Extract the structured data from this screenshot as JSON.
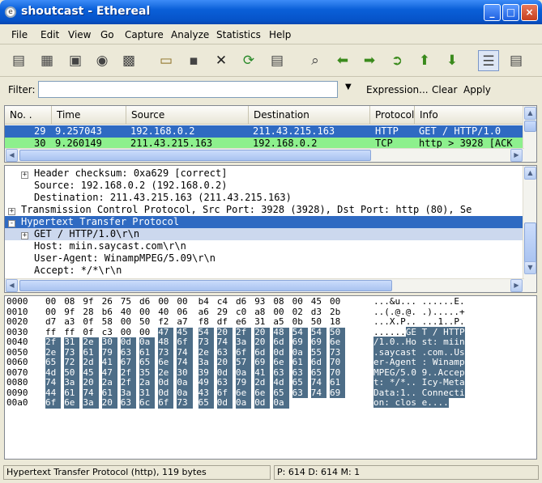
{
  "window": {
    "title": "shoutcast - Ethereal",
    "icon": "ethereal-app-icon"
  },
  "menu": [
    "File",
    "Edit",
    "View",
    "Go",
    "Capture",
    "Analyze",
    "Statistics",
    "Help"
  ],
  "toolbar_icons": [
    "interface-list-icon",
    "capture-options-icon",
    "start-capture-icon",
    "stop-capture-icon",
    "restart-capture-icon",
    "open-file-icon",
    "save-file-icon",
    "close-file-icon",
    "reload-icon",
    "print-icon",
    "find-packet-icon",
    "go-back-icon",
    "go-forward-icon",
    "go-to-packet-icon",
    "go-first-icon",
    "go-last-icon",
    "colorize-icon",
    "auto-scroll-icon"
  ],
  "filter": {
    "label": "Filter:",
    "value": "",
    "expression": "Expression...",
    "clear": "Clear",
    "apply": "Apply"
  },
  "packet_list": {
    "columns": [
      "No. .",
      "Time",
      "Source",
      "Destination",
      "Protocol",
      "Info"
    ],
    "rows": [
      {
        "no": "29",
        "time": "9.257043",
        "source": "192.168.0.2",
        "destination": "211.43.215.163",
        "protocol": "HTTP",
        "info": "GET / HTTP/1.0",
        "bg": "#2f6ac2",
        "fg": "#ffffff"
      },
      {
        "no": "30",
        "time": "9.260149",
        "source": "211.43.215.163",
        "destination": "192.168.0.2",
        "protocol": "TCP",
        "info": "http > 3928 [ACK",
        "bg": "#8df08d",
        "fg": "#000000"
      }
    ]
  },
  "details": {
    "rows": [
      {
        "indent": 1,
        "expander": "+",
        "text": "Header checksum: 0xa629 [correct]"
      },
      {
        "indent": 2,
        "expander": "",
        "text": "Source: 192.168.0.2 (192.168.0.2)"
      },
      {
        "indent": 2,
        "expander": "",
        "text": "Destination: 211.43.215.163 (211.43.215.163)"
      },
      {
        "indent": 0,
        "expander": "+",
        "text": "Transmission Control Protocol, Src Port: 3928 (3928), Dst Port: http (80), Se"
      },
      {
        "indent": 0,
        "expander": "-",
        "text": "Hypertext Transfer Protocol",
        "selected": true
      },
      {
        "indent": 1,
        "expander": "+",
        "text": "GET / HTTP/1.0\\r\\n",
        "sub": true
      },
      {
        "indent": 2,
        "expander": "",
        "text": "Host: miin.saycast.com\\r\\n"
      },
      {
        "indent": 2,
        "expander": "",
        "text": "User-Agent: WinampMPEG/5.09\\r\\n"
      },
      {
        "indent": 2,
        "expander": "",
        "text": "Accept: */*\\r\\n"
      }
    ]
  },
  "hex": {
    "rows": [
      {
        "offset": "0000",
        "bytes": [
          "00",
          "08",
          "9f",
          "26",
          "75",
          "d6",
          "00",
          "00",
          "b4",
          "c4",
          "d6",
          "93",
          "08",
          "00",
          "45",
          "00"
        ],
        "ascii": "...&u... ......E.",
        "hl_start": -1
      },
      {
        "offset": "0010",
        "bytes": [
          "00",
          "9f",
          "28",
          "b6",
          "40",
          "00",
          "40",
          "06",
          "a6",
          "29",
          "c0",
          "a8",
          "00",
          "02",
          "d3",
          "2b"
        ],
        "ascii": "..(.@.@. .).....+",
        "hl_start": -1
      },
      {
        "offset": "0020",
        "bytes": [
          "d7",
          "a3",
          "0f",
          "58",
          "00",
          "50",
          "f2",
          "a7",
          "f8",
          "df",
          "e6",
          "31",
          "a5",
          "0b",
          "50",
          "18"
        ],
        "ascii": "...X.P.. ...1..P.",
        "hl_start": -1
      },
      {
        "offset": "0030",
        "bytes": [
          "ff",
          "ff",
          "0f",
          "c3",
          "00",
          "00",
          "47",
          "45",
          "54",
          "20",
          "2f",
          "20",
          "48",
          "54",
          "54",
          "50"
        ],
        "ascii": "......GE T / HTTP",
        "hl_start": 6
      },
      {
        "offset": "0040",
        "bytes": [
          "2f",
          "31",
          "2e",
          "30",
          "0d",
          "0a",
          "48",
          "6f",
          "73",
          "74",
          "3a",
          "20",
          "6d",
          "69",
          "69",
          "6e"
        ],
        "ascii": "/1.0..Ho st: miin",
        "hl_start": 0
      },
      {
        "offset": "0050",
        "bytes": [
          "2e",
          "73",
          "61",
          "79",
          "63",
          "61",
          "73",
          "74",
          "2e",
          "63",
          "6f",
          "6d",
          "0d",
          "0a",
          "55",
          "73"
        ],
        "ascii": ".saycast .com..Us",
        "hl_start": 0
      },
      {
        "offset": "0060",
        "bytes": [
          "65",
          "72",
          "2d",
          "41",
          "67",
          "65",
          "6e",
          "74",
          "3a",
          "20",
          "57",
          "69",
          "6e",
          "61",
          "6d",
          "70"
        ],
        "ascii": "er-Agent : Winamp",
        "hl_start": 0
      },
      {
        "offset": "0070",
        "bytes": [
          "4d",
          "50",
          "45",
          "47",
          "2f",
          "35",
          "2e",
          "30",
          "39",
          "0d",
          "0a",
          "41",
          "63",
          "63",
          "65",
          "70"
        ],
        "ascii": "MPEG/5.0 9..Accep",
        "hl_start": 0
      },
      {
        "offset": "0080",
        "bytes": [
          "74",
          "3a",
          "20",
          "2a",
          "2f",
          "2a",
          "0d",
          "0a",
          "49",
          "63",
          "79",
          "2d",
          "4d",
          "65",
          "74",
          "61"
        ],
        "ascii": "t: */*.. Icy-Meta",
        "hl_start": 0
      },
      {
        "offset": "0090",
        "bytes": [
          "44",
          "61",
          "74",
          "61",
          "3a",
          "31",
          "0d",
          "0a",
          "43",
          "6f",
          "6e",
          "6e",
          "65",
          "63",
          "74",
          "69"
        ],
        "ascii": "Data:1.. Connecti",
        "hl_start": 0
      },
      {
        "offset": "00a0",
        "bytes": [
          "6f",
          "6e",
          "3a",
          "20",
          "63",
          "6c",
          "6f",
          "73",
          "65",
          "0d",
          "0a",
          "0d",
          "0a"
        ],
        "ascii": "on: clos e....",
        "hl_start": 0
      }
    ]
  },
  "status": {
    "left": "Hypertext Transfer Protocol (http), 119 bytes",
    "right": "P: 614 D: 614 M: 1"
  }
}
